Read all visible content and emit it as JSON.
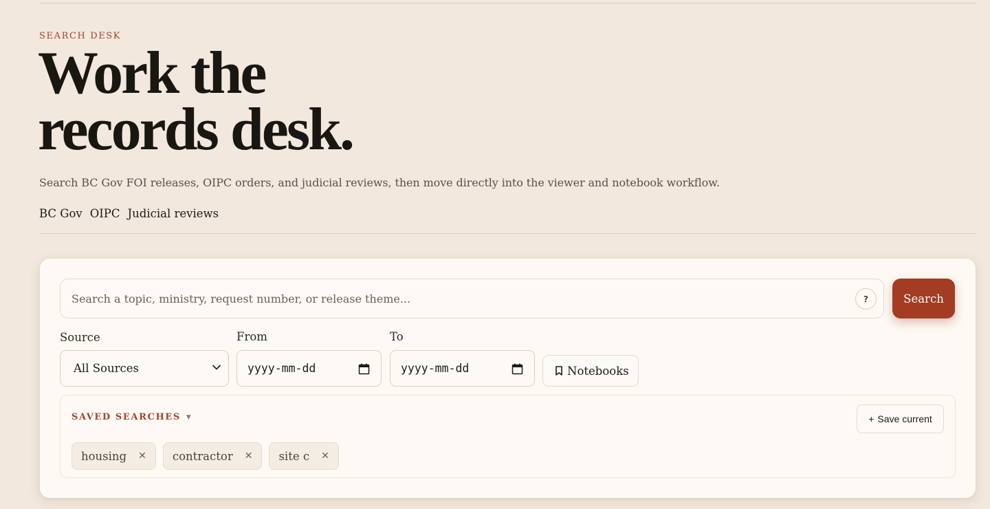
{
  "hero": {
    "eyebrow": "SEARCH DESK",
    "title_line1": "Work the",
    "title_line2": "records desk.",
    "lede": "Search BC Gov FOI releases, OIPC orders, and judicial reviews, then move directly into the viewer and notebook workflow.",
    "sources": [
      "BC Gov",
      "OIPC",
      "Judicial reviews"
    ]
  },
  "search": {
    "placeholder": "Search a topic, ministry, request number, or release theme...",
    "help_label": "?",
    "help_icon": "question-icon",
    "button_label": "Search"
  },
  "filters": {
    "source_label": "Source",
    "source_value": "All Sources",
    "from_label": "From",
    "from_value": "yyyy-mm-dd",
    "to_label": "To",
    "to_value": "yyyy-mm-dd",
    "notebooks_label": "Notebooks",
    "notebooks_icon": "bookmark-icon"
  },
  "saved_searches": {
    "title": "SAVED SEARCHES",
    "caret": "▼",
    "save_current_label": "Save current",
    "save_current_prefix": "+",
    "items": [
      {
        "label": "housing"
      },
      {
        "label": "contractor"
      },
      {
        "label": "site c"
      }
    ],
    "remove_glyph": "✕"
  },
  "colors": {
    "background": "#f2e8dd",
    "accent": "#a33c22",
    "panel": "#fdf9f4"
  }
}
